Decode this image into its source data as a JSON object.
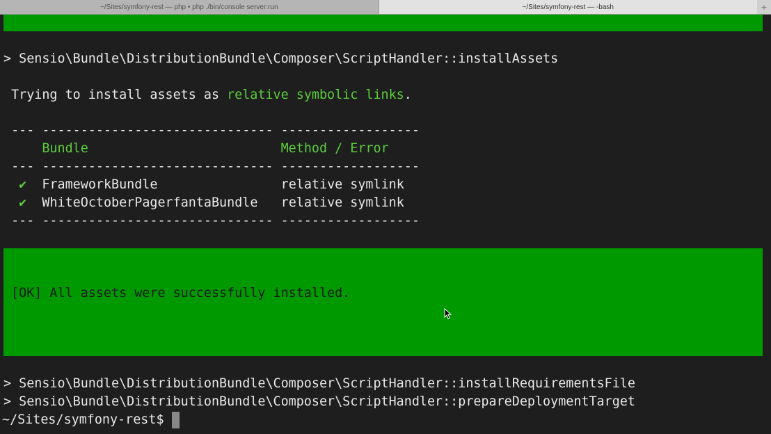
{
  "tabs": [
    {
      "label": "~/Sites/symfony-rest — php • php ./bin/console server:run"
    },
    {
      "label": "~/Sites/symfony-rest — -bash"
    }
  ],
  "new_tab": "+",
  "terminal": {
    "cmd1": "> Sensio\\Bundle\\DistributionBundle\\Composer\\ScriptHandler::installAssets",
    "trying_prefix": " Trying to install assets as ",
    "trying_highlight": "relative symbolic links",
    "trying_suffix": ".",
    "rule": " --- ------------------------------ ------------------",
    "header_bundle": "     Bundle                         ",
    "header_method": "Method / Error",
    "check": "✔",
    "rows": [
      {
        "bundle": "FrameworkBundle                ",
        "method": "relative symlink"
      },
      {
        "bundle": "WhiteOctoberPagerfantaBundle   ",
        "method": "relative symlink"
      }
    ],
    "ok_message": " [OK] All assets were successfully installed.",
    "cmd2": "> Sensio\\Bundle\\DistributionBundle\\Composer\\ScriptHandler::installRequirementsFile",
    "cmd3": "> Sensio\\Bundle\\DistributionBundle\\Composer\\ScriptHandler::prepareDeploymentTarget",
    "prompt": "~/Sites/symfony-rest$ "
  },
  "colors": {
    "green_bg": "#009a00",
    "green_text": "#5ccc3c",
    "background": "#1e1e1e"
  }
}
